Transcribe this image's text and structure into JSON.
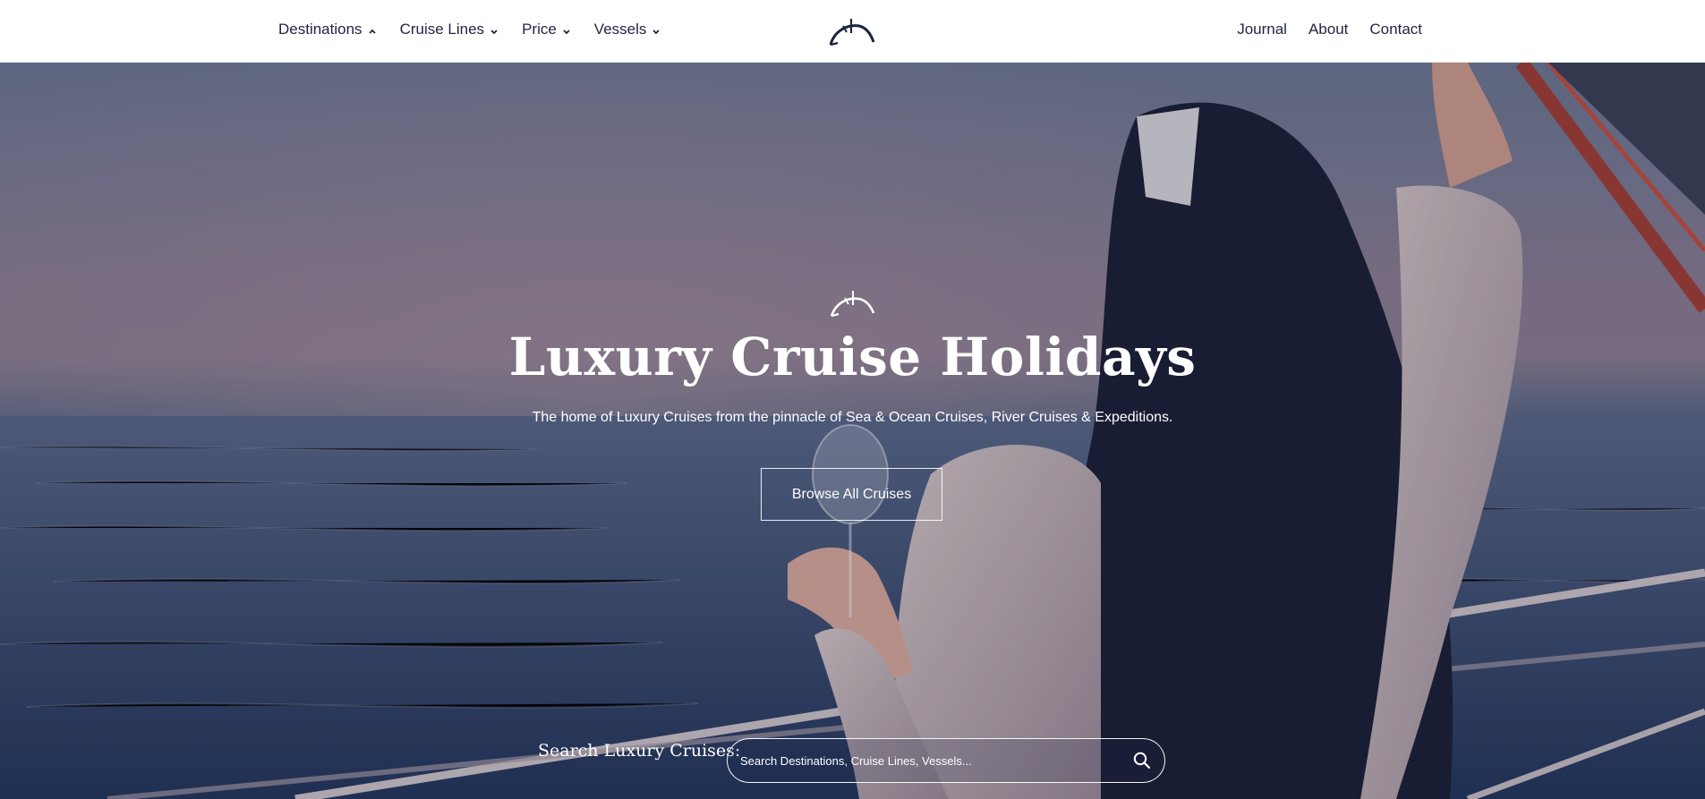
{
  "header": {
    "nav_left": [
      {
        "label": "Destinations",
        "icon": "chevron-up-icon"
      },
      {
        "label": "Cruise Lines",
        "icon": "chevron-down-icon"
      },
      {
        "label": "Price",
        "icon": "chevron-down-icon"
      },
      {
        "label": "Vessels",
        "icon": "chevron-down-icon"
      }
    ],
    "nav_right": [
      {
        "label": "Journal"
      },
      {
        "label": "About"
      },
      {
        "label": "Contact"
      }
    ],
    "logo_icon": "ship-arc-logo-icon"
  },
  "hero": {
    "mark_icon": "ship-arc-logo-icon",
    "title": "Luxury Cruise Holidays",
    "subtitle": "The home of Luxury Cruises from the pinnacle of Sea & Ocean Cruises, River Cruises & Expeditions.",
    "cta_label": "Browse All Cruises"
  },
  "search": {
    "label": "Search Luxury Cruises:",
    "placeholder": "Search Destinations, Cruise Lines, Vessels...",
    "icon": "search-icon"
  },
  "colors": {
    "nav_text": "#1f2443",
    "logo_navy": "#1c2340",
    "hero_text": "#ffffff"
  }
}
